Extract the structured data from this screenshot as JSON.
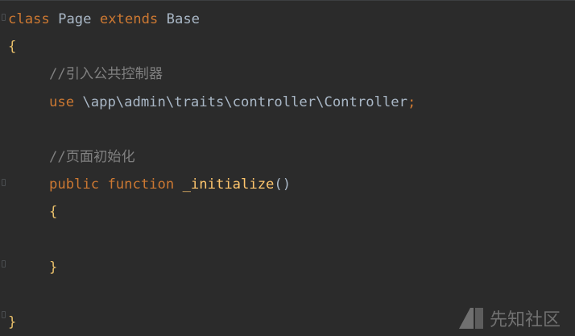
{
  "code": {
    "line1": {
      "kw1": "class",
      "name": " Page ",
      "kw2": "extends",
      "base": " Base"
    },
    "line2": {
      "brace": "{"
    },
    "line3": {
      "comment": "//引入公共控制器"
    },
    "line4": {
      "kw": "use",
      "path": " \\app\\admin\\traits\\controller\\Controller",
      "semi": ";"
    },
    "line5": {
      "text": ""
    },
    "line6": {
      "comment": "//页面初始化"
    },
    "line7": {
      "kw1": "public",
      "kw2": " function",
      "fn": " _initialize",
      "parens": "()"
    },
    "line8": {
      "brace": "{"
    },
    "line9": {
      "text": ""
    },
    "line10": {
      "brace": "}"
    },
    "line11": {
      "text": ""
    },
    "line12": {
      "brace": "}"
    }
  },
  "watermark": {
    "text": "先知社区"
  },
  "colors": {
    "background": "#2b2b2b",
    "keyword": "#cc7832",
    "comment": "#808080",
    "function": "#ffc66d",
    "text": "#a9b7c6"
  }
}
